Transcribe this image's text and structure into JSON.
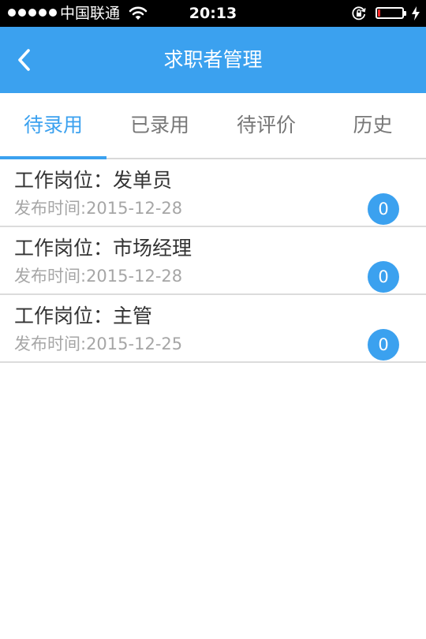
{
  "status_bar": {
    "carrier": "中国联通",
    "time": "20:13",
    "icons": [
      "signal-dots-icon",
      "wifi-icon",
      "rotation-lock-icon",
      "battery-icon",
      "charging-bolt-icon"
    ],
    "battery_level": 0.1,
    "battery_color": "#ff2a2a"
  },
  "nav": {
    "title": "求职者管理",
    "back_icon": "chevron-left-icon",
    "background": "#3ba1ef"
  },
  "tabs": [
    {
      "label": "待录用",
      "active": true
    },
    {
      "label": "已录用",
      "active": false
    },
    {
      "label": "待评价",
      "active": false
    },
    {
      "label": "历史",
      "active": false
    }
  ],
  "jobs": [
    {
      "title": "工作岗位：发单员",
      "date": "发布时间:2015-12-28",
      "count": "0"
    },
    {
      "title": "工作岗位：市场经理",
      "date": "发布时间:2015-12-28",
      "count": "0"
    },
    {
      "title": "工作岗位：主管",
      "date": "发布时间:2015-12-25",
      "count": "0"
    }
  ],
  "colors": {
    "accent": "#3ba1ef",
    "text_primary": "#333333",
    "text_secondary": "#a6a6a6",
    "tab_inactive": "#777777"
  }
}
